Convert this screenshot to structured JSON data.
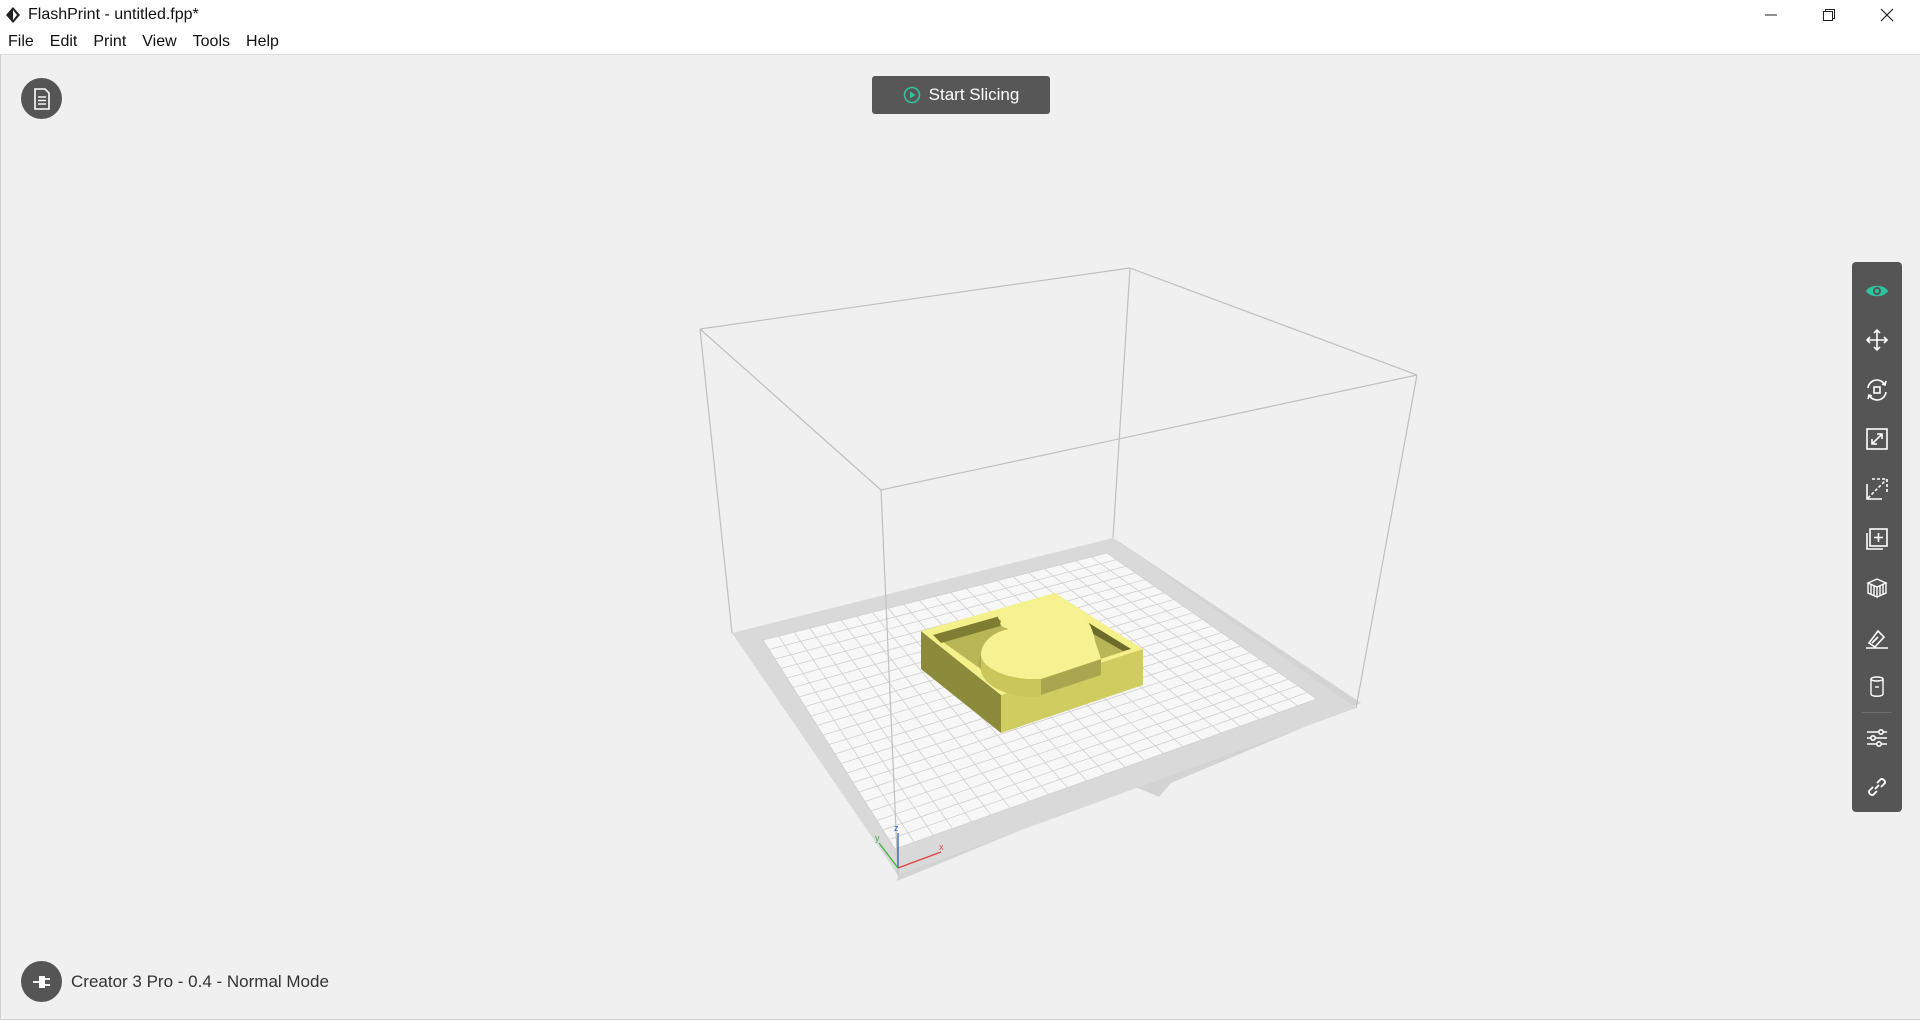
{
  "window": {
    "title": "FlashPrint - untitled.fpp*"
  },
  "menu": {
    "items": [
      "File",
      "Edit",
      "Print",
      "View",
      "Tools",
      "Help"
    ]
  },
  "toolbar": {
    "start_slicing_label": "Start Slicing"
  },
  "right_tools": [
    {
      "icon": "eye-icon",
      "name": "view"
    },
    {
      "icon": "move-icon",
      "name": "move"
    },
    {
      "icon": "rotate-icon",
      "name": "rotate"
    },
    {
      "icon": "scale-icon",
      "name": "scale"
    },
    {
      "icon": "cut-icon",
      "name": "cut"
    },
    {
      "icon": "add-model-icon",
      "name": "add-model"
    },
    {
      "icon": "supports-icon",
      "name": "supports"
    },
    {
      "icon": "lay-on-face-icon",
      "name": "lay-on-face"
    },
    {
      "icon": "extruder-icon",
      "name": "extruder"
    },
    {
      "icon": "settings-sliders-icon",
      "name": "settings"
    },
    {
      "icon": "link-icon",
      "name": "link"
    }
  ],
  "status": {
    "machine": "Creator 3 Pro - 0.4 - Normal Mode"
  },
  "axes": {
    "x": "x",
    "y": "y",
    "z": "z"
  },
  "colors": {
    "accent": "#2ec4a0",
    "model": "#f4f08a",
    "panel": "#555555"
  }
}
